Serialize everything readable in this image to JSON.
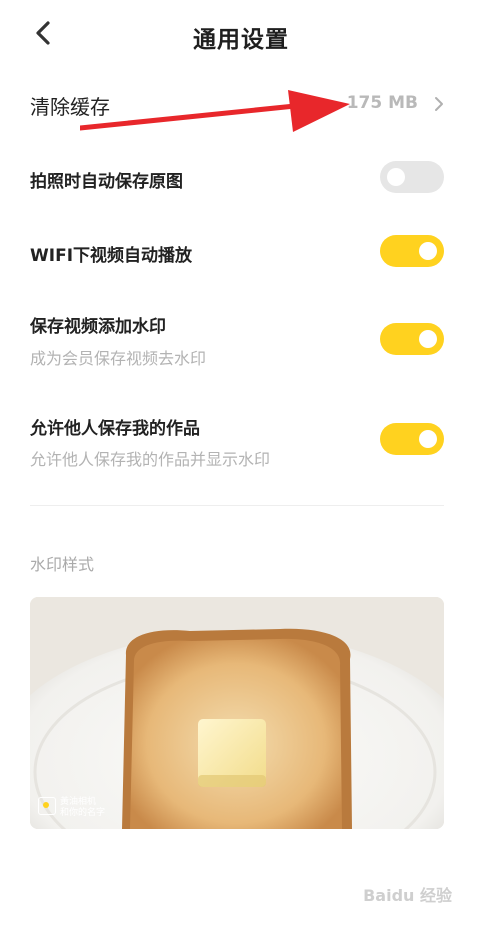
{
  "header": {
    "title": "通用设置"
  },
  "cache": {
    "label": "清除缓存",
    "value": "175 MB"
  },
  "settings": [
    {
      "label": "拍照时自动保存原图",
      "sub": "",
      "on": false
    },
    {
      "label": "WIFI下视频自动播放",
      "sub": "",
      "on": true
    },
    {
      "label": "保存视频添加水印",
      "sub": "成为会员保存视频去水印",
      "on": true
    },
    {
      "label": "允许他人保存我的作品",
      "sub": "允许他人保存我的作品并显示水印",
      "on": true
    }
  ],
  "watermark_section": {
    "title": "水印样式",
    "mark_line1": "黃油相机",
    "mark_line2": "和你的名字"
  },
  "footer": {
    "source_watermark": "Baidu 经验"
  },
  "colors": {
    "accent": "#FFD21F",
    "toggle_off": "#e6e6e6",
    "annotation": "#e8272b"
  }
}
